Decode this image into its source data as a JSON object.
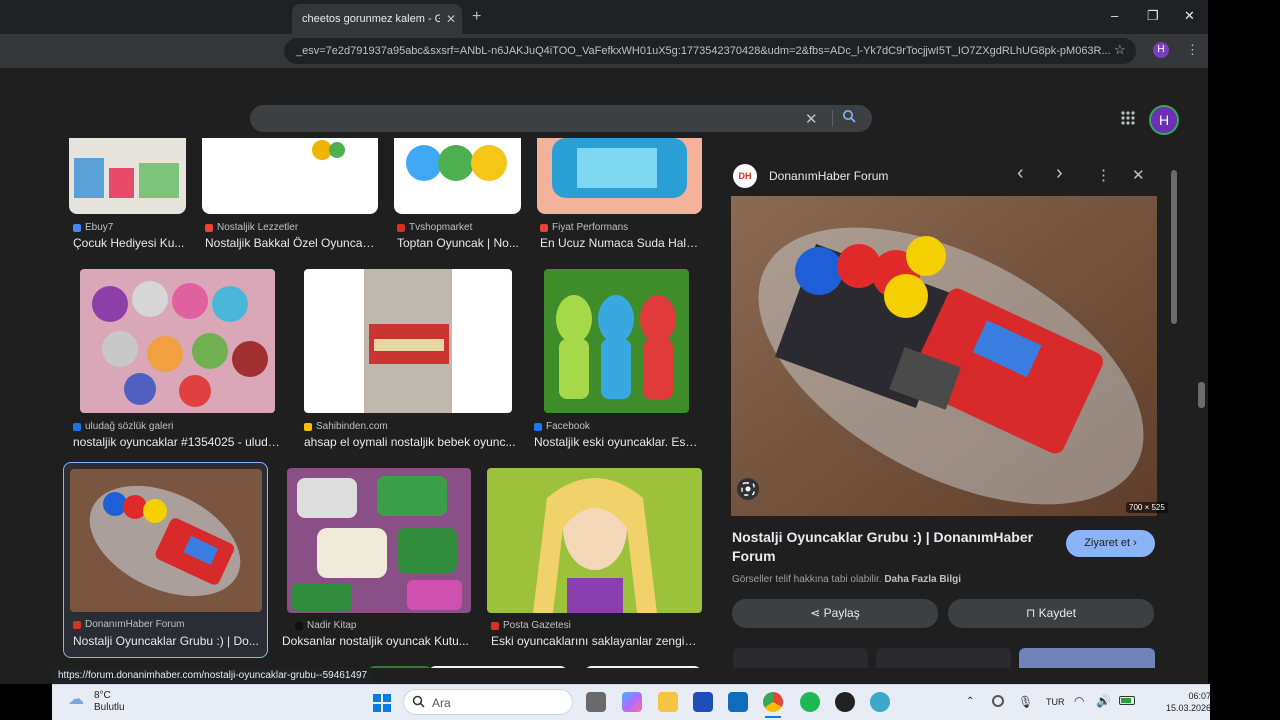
{
  "browser": {
    "tab_title": "cheetos gorunmez kalem - Goo",
    "tab_close": "✕",
    "new_tab": "+",
    "url": "_esv=7e2d791937a95abc&sxsrf=ANbL-n6JAKJuQ4iTOO_VaFefkxWH01uX5g:1773542370428&udm=2&fbs=ADc_l-Yk7dC9rTocjjwI5T_IO7ZXgdRLhUG8pk-pM063R...",
    "profile_initial": "H",
    "win_min": "–",
    "win_max": "❐",
    "win_close": "✕"
  },
  "google": {
    "clear": "✕",
    "search_icon": "🔍",
    "apps_icon": "⋮⋮⋮",
    "avatar_initial": "H"
  },
  "results": {
    "row1": [
      {
        "source": "Ebuy7",
        "title": "Çocuk Hediyesi Ku...",
        "fav_color": "#4285f4"
      },
      {
        "source": "Nostaljik Lezzetler",
        "title": "Nostaljik Bakkal Özel Oyuncak...",
        "fav_color": "#ea4335"
      },
      {
        "source": "Tvshopmarket",
        "title": "Toptan Oyuncak | No...",
        "fav_color": "#d93025"
      },
      {
        "source": "Fiyat Performans",
        "title": "En Ucuz Numaca Suda Halk...",
        "fav_color": "#e94235"
      }
    ],
    "row2": [
      {
        "source": "uludağ sözlük galeri",
        "title": "nostaljik oyuncaklar #1354025 - uluda...",
        "fav_color": "#1a73e8"
      },
      {
        "source": "Sahibinden.com",
        "title": "ahsap el oymali nostaljik bebek oyunc...",
        "fav_color": "#fbbc04"
      },
      {
        "source": "Facebook",
        "title": "Nostaljik eski oyuncaklar. Esk...",
        "fav_color": "#1877f2"
      }
    ],
    "row3": [
      {
        "source": "DonanımHaber Forum",
        "title": "Nostalji Oyuncaklar Grubu :) | Do...",
        "fav_color": "#d93025"
      },
      {
        "source": "Nadir Kitap",
        "title": "Doksanlar nostaljik oyuncak Kutu...",
        "fav_color": "#111111"
      },
      {
        "source": "Posta Gazetesi",
        "title": "Eski oyuncaklarını saklayanlar zengin ...",
        "fav_color": "#d93025"
      }
    ]
  },
  "panel": {
    "logo": "DH",
    "site": "DonanımHaber Forum",
    "prev": "‹",
    "next": "›",
    "more": "⋮",
    "close": "✕",
    "dimensions": "700 × 525",
    "title": "Nostalji Oyuncaklar Grubu :) | DonanımHaber Forum",
    "visit": "Ziyaret et  ›",
    "copyright": "Görseller telif hakkına tabi olabilir.",
    "learn_more": "Daha Fazla Bilgi",
    "share": "Paylaş",
    "save": "Kaydet"
  },
  "status_url": "https://forum.donanimhaber.com/nostalji-oyuncaklar-grubu--59461497",
  "taskbar": {
    "temperature": "8°C",
    "weather": "Bulutlu",
    "search_placeholder": "Ara",
    "language": "TUR",
    "time": "06:07",
    "date": "15.03.2026"
  }
}
